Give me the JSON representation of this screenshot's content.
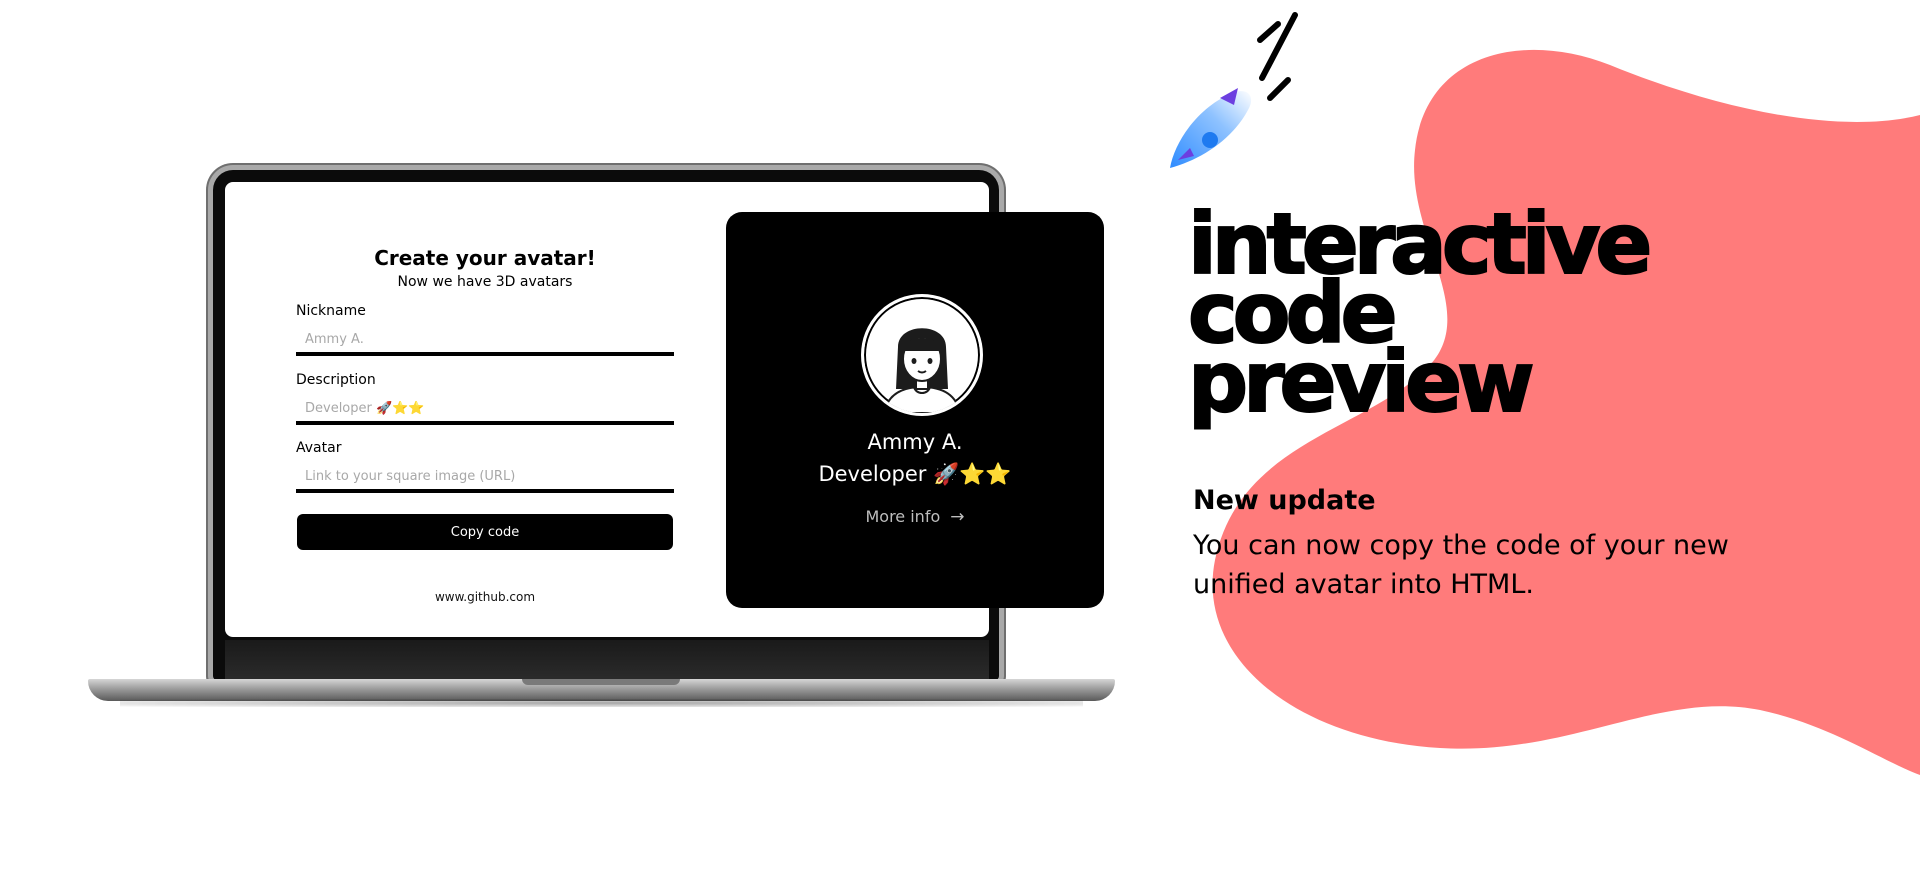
{
  "colors": {
    "accent_blob": "#ff7b7b",
    "card_background": "#000000",
    "button_background": "#000000"
  },
  "form": {
    "title": "Create your avatar!",
    "subtitle": "Now we have 3D avatars",
    "nickname": {
      "label": "Nickname",
      "placeholder": "Ammy A."
    },
    "description": {
      "label": "Description",
      "placeholder": "Developer 🚀⭐⭐"
    },
    "avatar": {
      "label": "Avatar",
      "placeholder": "Link to your square image (URL)"
    },
    "copy_button": "Copy code",
    "footer_link": "www.github.com"
  },
  "card": {
    "name": "Ammy A.",
    "role": "Developer 🚀⭐⭐",
    "more_info": "More info",
    "arrow": "→",
    "avatar_icon": "girl-avatar-icon"
  },
  "hero": {
    "headline": [
      "interactive",
      "code",
      "preview"
    ],
    "update_title": "New update",
    "update_body": "You can now copy the code of your new unified avatar into HTML.",
    "rocket_icon": "rocket-icon"
  }
}
